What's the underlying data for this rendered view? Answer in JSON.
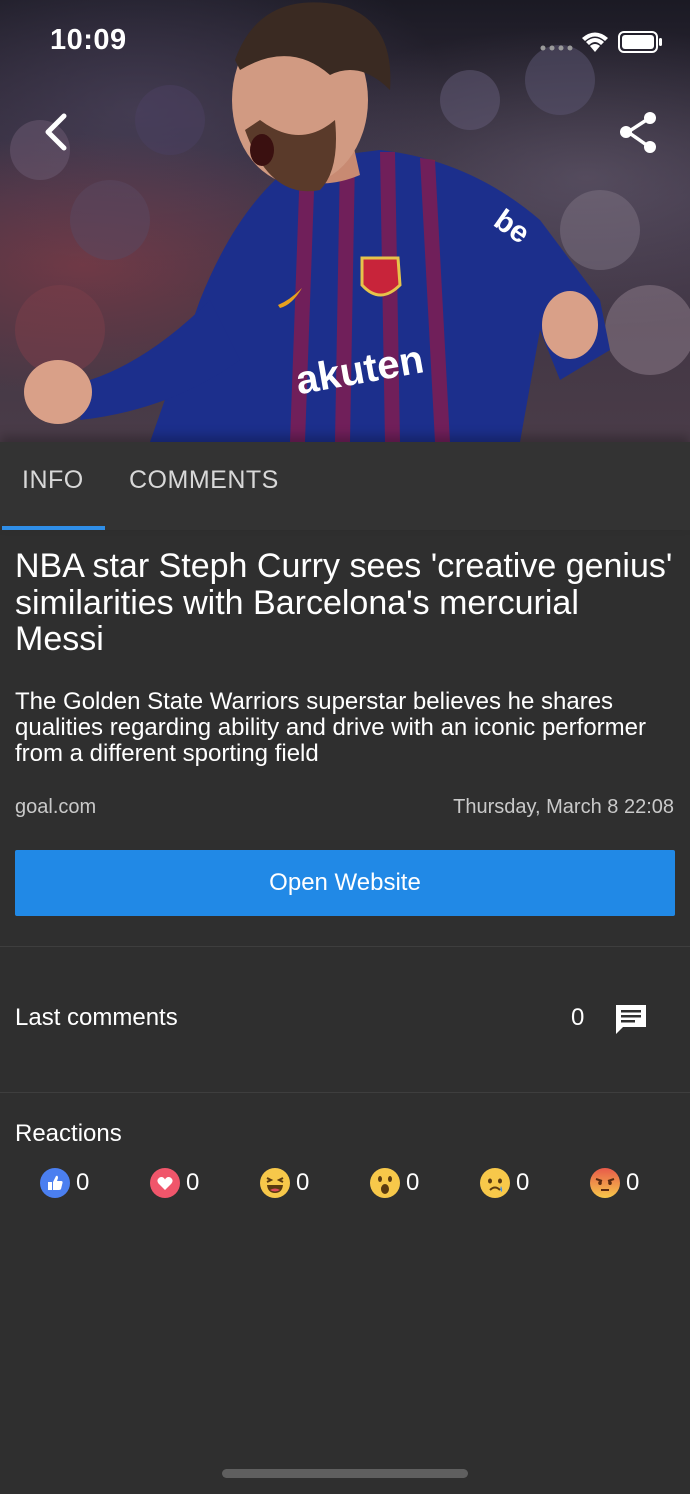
{
  "status_bar": {
    "time": "10:09"
  },
  "hero": {
    "image_alt": "Footballer in Barcelona kit celebrating"
  },
  "tabs": [
    {
      "label": "INFO",
      "active": true
    },
    {
      "label": "COMMENTS",
      "active": false
    }
  ],
  "article": {
    "headline": "NBA star Steph Curry sees 'creative genius' similarities with Barcelona's mercurial Messi",
    "summary": "The Golden State Warriors superstar believes he shares qualities regarding ability and drive with an iconic performer from a different sporting field",
    "source": "goal.com",
    "date": "Thursday, March 8 22:08",
    "open_button_label": "Open Website"
  },
  "comments": {
    "label": "Last comments",
    "count": "0",
    "icon": "comment-icon"
  },
  "reactions": {
    "title": "Reactions",
    "items": [
      {
        "name": "like",
        "count": "0",
        "color": "#4b7ff0"
      },
      {
        "name": "love",
        "count": "0",
        "color": "#f0566b"
      },
      {
        "name": "haha",
        "count": "0",
        "color": "#f7c84a"
      },
      {
        "name": "wow",
        "count": "0",
        "color": "#f7c84a"
      },
      {
        "name": "sad",
        "count": "0",
        "color": "#f7c84a"
      },
      {
        "name": "angry",
        "count": "0",
        "color": "#ee7a50"
      }
    ]
  },
  "colors": {
    "accent": "#2189e6",
    "background": "#2f2f2f",
    "tab_bar": "#333333"
  }
}
